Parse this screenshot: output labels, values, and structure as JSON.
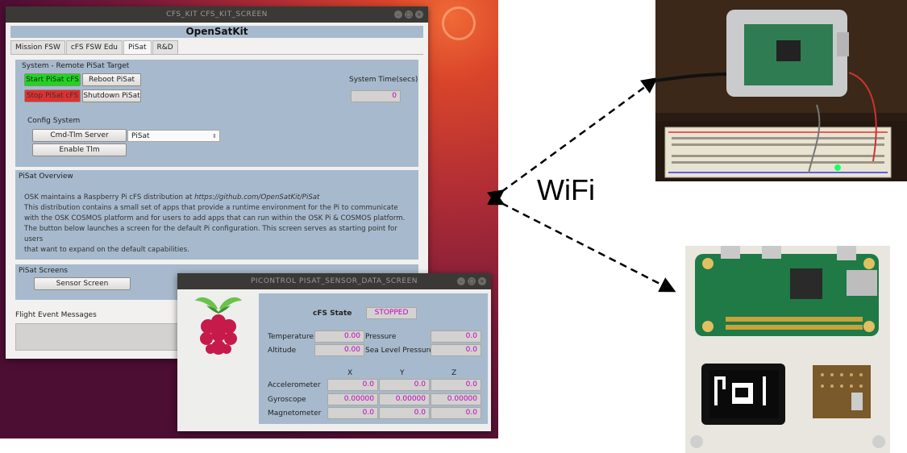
{
  "main_window": {
    "title": "CFS_KIT CFS_KIT_SCREEN",
    "header": "OpenSatKit",
    "tabs": [
      {
        "label": "Mission FSW",
        "active": false
      },
      {
        "label": "cFS FSW Edu",
        "active": false
      },
      {
        "label": "PiSat",
        "active": true
      },
      {
        "label": "R&D",
        "active": false
      }
    ],
    "system_section": {
      "title": "System - Remote PiSat Target",
      "start_button": "Start PiSat cFS",
      "reboot_button": "Reboot PiSat",
      "stop_button": "Stop PiSat cFS",
      "shutdown_button": "Shutdown PiSat",
      "system_time_label": "System Time(secs)",
      "system_time_value": "0",
      "config_title": "Config System",
      "cmd_tlm_server_button": "Cmd-Tlm Server",
      "cmd_tlm_select": "PiSat",
      "enable_tlm_button": "Enable Tlm"
    },
    "overview": {
      "title": "PiSat Overview",
      "line1_prefix": "OSK maintains a Raspberry Pi cFS distribution at ",
      "line1_url": "https://github.com/OpenSatKit/PiSat",
      "line2": "This distribution contains a small set of apps that provide a runtime environment for the Pi to communicate",
      "line3": "with the OSK COSMOS platform and for users to add apps that can run within the OSK Pi & COSMOS platform.",
      "line4": "The button below launches a screen for the default Pi configuration. This screen serves as starting point for users",
      "line5": "that want to expand on the default capabilities."
    },
    "screens": {
      "title": "PiSat Screens",
      "sensor_button": "Sensor Screen"
    },
    "flight_events": {
      "title": "Flight Event Messages"
    }
  },
  "sensor_window": {
    "title": "PICONTROL PISAT_SENSOR_DATA_SCREEN",
    "logo_icon": "raspberry-pi-logo",
    "cfs_state_label": "cFS State",
    "cfs_state_value": "STOPPED",
    "temperature_label": "Temperature",
    "temperature_value": "0.00",
    "pressure_label": "Pressure",
    "pressure_value": "0.0",
    "altitude_label": "Altitude",
    "altitude_value": "0.00",
    "sea_level_label": "Sea Level Pressure",
    "sea_level_value": "0.0",
    "axis_labels": [
      "X",
      "Y",
      "Z"
    ],
    "rows": [
      {
        "label": "Accelerometer",
        "values": [
          "0.0",
          "0.0",
          "0.0"
        ]
      },
      {
        "label": "Gyroscope",
        "values": [
          "0.00000",
          "0.00000",
          "0.00000"
        ]
      },
      {
        "label": "Magnetometer",
        "values": [
          "0.0",
          "0.0",
          "0.0"
        ]
      }
    ]
  },
  "wifi_label": "WiFi",
  "colors": {
    "panel": "#a7bacd",
    "value_text": "#c000c0",
    "start_button": "#1fd61f",
    "stop_button": "#e03030"
  }
}
